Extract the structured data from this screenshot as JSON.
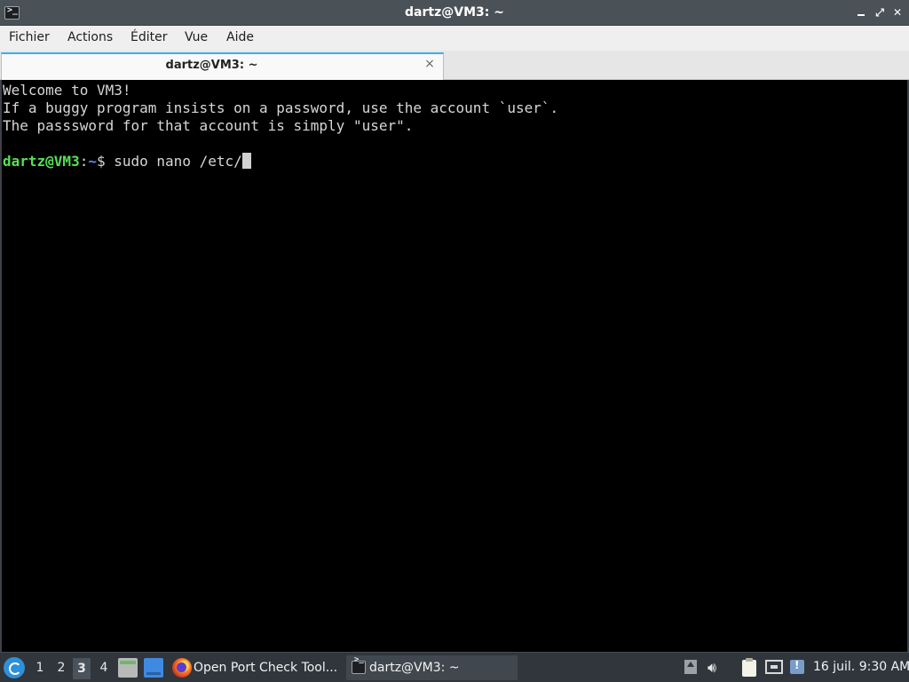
{
  "window": {
    "title": "dartz@VM3: ~",
    "icon": "terminal-icon",
    "controls": [
      "minimize-icon",
      "maximize-icon",
      "close-icon"
    ]
  },
  "menu": {
    "items": [
      "Fichier",
      "Actions",
      "Éditer",
      "Vue",
      "Aide"
    ]
  },
  "tab": {
    "label": "dartz@VM3: ~",
    "close_glyph": "×"
  },
  "terminal": {
    "lines": [
      "Welcome to VM3!",
      "If a buggy program insists on a password, use the account `user`.",
      "The passsword for that account is simply \"user\".",
      ""
    ],
    "prompt": {
      "user_host": "dartz@VM3",
      "colon": ":",
      "path": "~",
      "symbol": "$ ",
      "command": "sudo nano /etc/"
    },
    "colors": {
      "user_host": "#55e055",
      "path": "#5a8cff",
      "text": "#d6d6d6",
      "background": "#000000"
    }
  },
  "taskbar": {
    "workspaces": [
      "1",
      "2",
      "3",
      "4"
    ],
    "active_workspace": "3",
    "launchers": [
      "start-menu-icon",
      "file-manager-icon",
      "show-desktop-icon"
    ],
    "tasks": [
      {
        "label": "Open Port Check Tool...",
        "icon": "firefox-icon"
      },
      {
        "label": "dartz@VM3: ~",
        "icon": "terminal-icon"
      }
    ],
    "tray": [
      "tray-up-arrow-icon",
      "volume-icon",
      "clipboard-icon",
      "network-icon",
      "update-notifier-icon"
    ],
    "clock": "16 juil. 9:30 AM"
  }
}
